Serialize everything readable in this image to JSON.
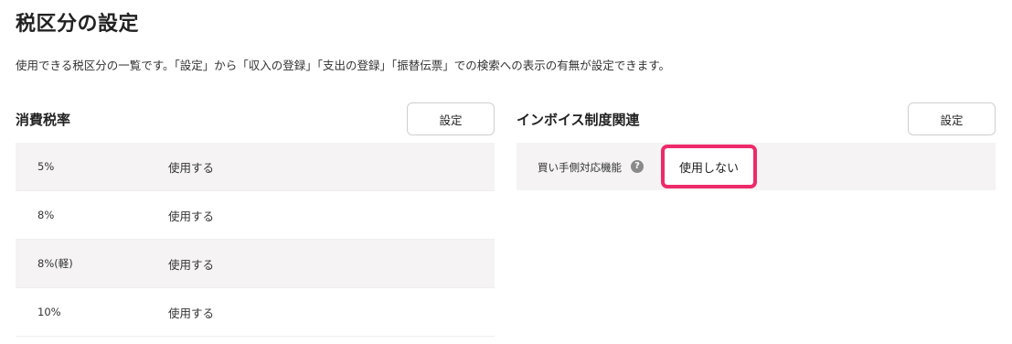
{
  "page": {
    "title": "税区分の設定",
    "description": "使用できる税区分の一覧です。「設定」から「収入の登録」「支出の登録」「振替伝票」での検索への表示の有無が設定できます。"
  },
  "consumption_tax": {
    "title": "消費税率",
    "button_label": "設定",
    "rows": [
      {
        "rate": "5%",
        "status": "使用する"
      },
      {
        "rate": "8%",
        "status": "使用する"
      },
      {
        "rate": "8%(軽)",
        "status": "使用する"
      },
      {
        "rate": "10%",
        "status": "使用する"
      }
    ]
  },
  "invoice": {
    "title": "インボイス制度関連",
    "button_label": "設定",
    "row": {
      "label": "買い手側対応機能",
      "help_icon": "?",
      "status": "使用しない"
    }
  },
  "colors": {
    "highlight_border": "#ee2a6a",
    "row_shade": "#f5f3f3"
  }
}
